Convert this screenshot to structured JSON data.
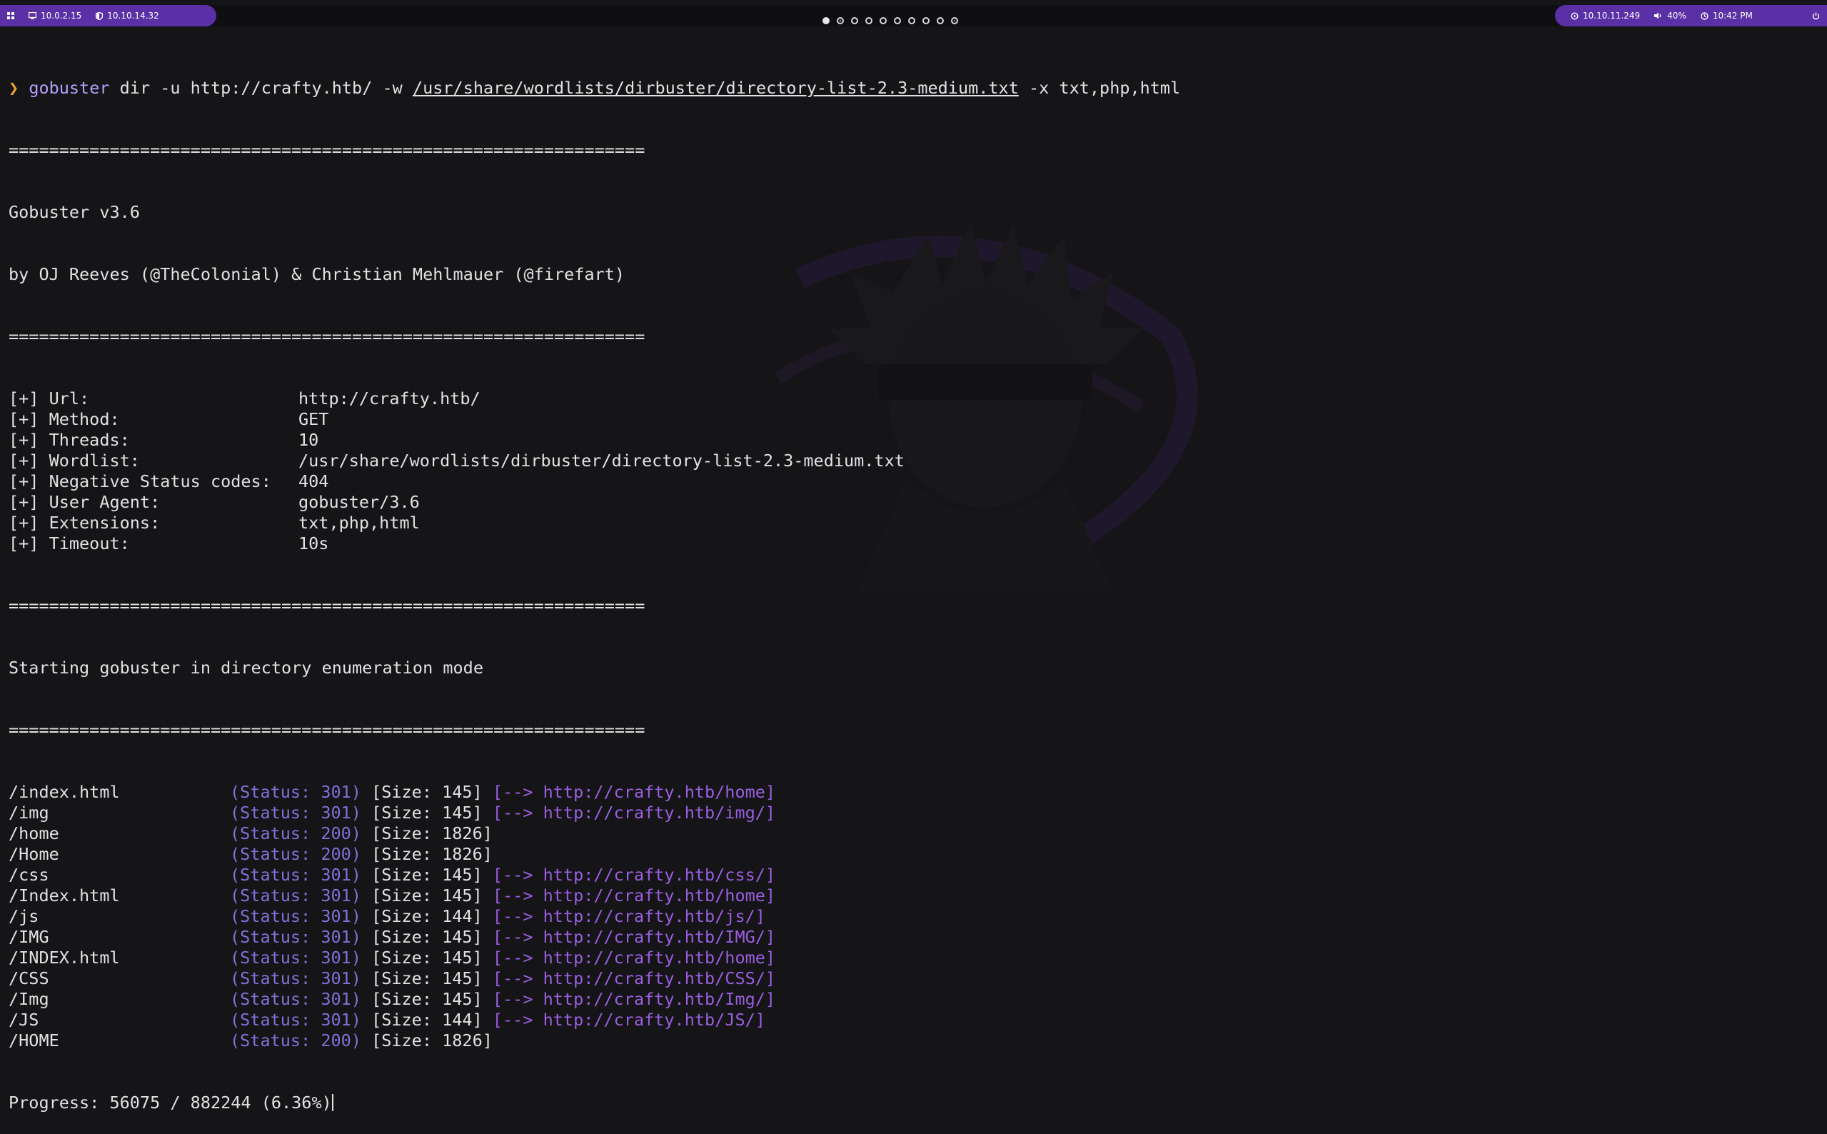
{
  "topbar": {
    "left_ips": [
      {
        "icon": "monitor-icon",
        "label": "10.0.2.15"
      },
      {
        "icon": "shield-icon",
        "label": "10.10.14.32"
      }
    ],
    "workspaces": [
      {
        "state": "active"
      },
      {
        "state": "occupied"
      },
      {
        "state": "empty"
      },
      {
        "state": "empty"
      },
      {
        "state": "empty"
      },
      {
        "state": "empty"
      },
      {
        "state": "empty"
      },
      {
        "state": "empty"
      },
      {
        "state": "empty"
      },
      {
        "state": "occupied"
      }
    ],
    "target_ip": "10.10.11.249",
    "volume": "40%",
    "time": "10:42 PM"
  },
  "terminal": {
    "prompt_symbol": "❯",
    "command_name": "gobuster",
    "command_args_1": " dir -u http://crafty.htb/ -w ",
    "command_wordlist": "/usr/share/wordlists/dirbuster/directory-list-2.3-medium.txt",
    "command_args_2": " -x txt,php,html",
    "separator": "===============================================================",
    "version": "Gobuster v3.6",
    "authors": "by OJ Reeves (@TheColonial) & Christian Mehlmauer (@firefart)",
    "options": [
      {
        "label": "[+] Url:",
        "value": "http://crafty.htb/"
      },
      {
        "label": "[+] Method:",
        "value": "GET"
      },
      {
        "label": "[+] Threads:",
        "value": "10"
      },
      {
        "label": "[+] Wordlist:",
        "value": "/usr/share/wordlists/dirbuster/directory-list-2.3-medium.txt"
      },
      {
        "label": "[+] Negative Status codes:",
        "value": "404"
      },
      {
        "label": "[+] User Agent:",
        "value": "gobuster/3.6"
      },
      {
        "label": "[+] Extensions:",
        "value": "txt,php,html"
      },
      {
        "label": "[+] Timeout:",
        "value": "10s"
      }
    ],
    "start_message": "Starting gobuster in directory enumeration mode",
    "results": [
      {
        "path": "/index.html",
        "status": "(Status: 301)",
        "size": "[Size: 145]",
        "redirect": "[--> http://crafty.htb/home]"
      },
      {
        "path": "/img",
        "status": "(Status: 301)",
        "size": "[Size: 145]",
        "redirect": "[--> http://crafty.htb/img/]"
      },
      {
        "path": "/home",
        "status": "(Status: 200)",
        "size": "[Size: 1826]",
        "redirect": ""
      },
      {
        "path": "/Home",
        "status": "(Status: 200)",
        "size": "[Size: 1826]",
        "redirect": ""
      },
      {
        "path": "/css",
        "status": "(Status: 301)",
        "size": "[Size: 145]",
        "redirect": "[--> http://crafty.htb/css/]"
      },
      {
        "path": "/Index.html",
        "status": "(Status: 301)",
        "size": "[Size: 145]",
        "redirect": "[--> http://crafty.htb/home]"
      },
      {
        "path": "/js",
        "status": "(Status: 301)",
        "size": "[Size: 144]",
        "redirect": "[--> http://crafty.htb/js/]"
      },
      {
        "path": "/IMG",
        "status": "(Status: 301)",
        "size": "[Size: 145]",
        "redirect": "[--> http://crafty.htb/IMG/]"
      },
      {
        "path": "/INDEX.html",
        "status": "(Status: 301)",
        "size": "[Size: 145]",
        "redirect": "[--> http://crafty.htb/home]"
      },
      {
        "path": "/CSS",
        "status": "(Status: 301)",
        "size": "[Size: 145]",
        "redirect": "[--> http://crafty.htb/CSS/]"
      },
      {
        "path": "/Img",
        "status": "(Status: 301)",
        "size": "[Size: 145]",
        "redirect": "[--> http://crafty.htb/Img/]"
      },
      {
        "path": "/JS",
        "status": "(Status: 301)",
        "size": "[Size: 144]",
        "redirect": "[--> http://crafty.htb/JS/]"
      },
      {
        "path": "/HOME",
        "status": "(Status: 200)",
        "size": "[Size: 1826]",
        "redirect": ""
      }
    ],
    "progress": "Progress: 56075 / 882244 (6.36%)"
  },
  "colors": {
    "background": "#151417",
    "topbar_pill": "#5b2fa6",
    "prompt": "#f0a030",
    "command": "#b6a0ff",
    "status": "#7f72d8",
    "redirect": "#9a5fe0",
    "text": "#e2e2e2"
  }
}
